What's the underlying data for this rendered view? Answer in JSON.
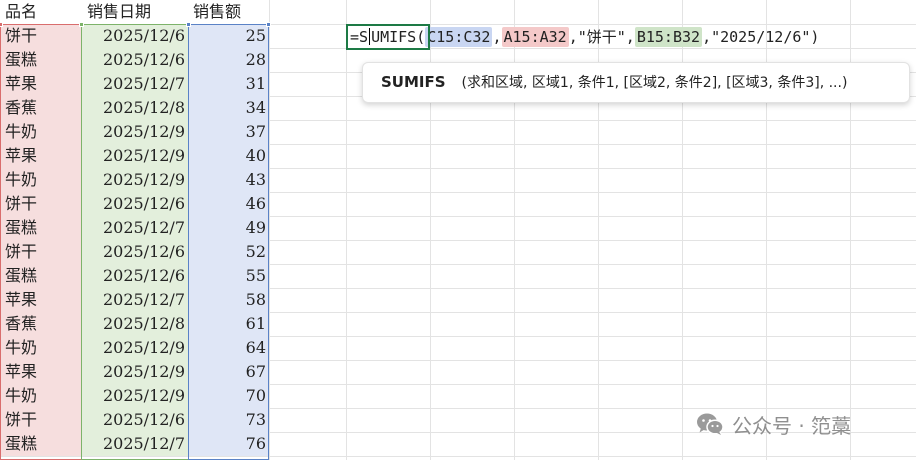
{
  "spreadsheet": {
    "headers": [
      "品名",
      "销售日期",
      "销售额"
    ],
    "rows": [
      [
        "饼干",
        "2025/12/6",
        "25"
      ],
      [
        "蛋糕",
        "2025/12/6",
        "28"
      ],
      [
        "苹果",
        "2025/12/7",
        "31"
      ],
      [
        "香蕉",
        "2025/12/8",
        "34"
      ],
      [
        "牛奶",
        "2025/12/9",
        "37"
      ],
      [
        "苹果",
        "2025/12/9",
        "40"
      ],
      [
        "牛奶",
        "2025/12/9",
        "43"
      ],
      [
        "饼干",
        "2025/12/6",
        "46"
      ],
      [
        "蛋糕",
        "2025/12/7",
        "49"
      ],
      [
        "饼干",
        "2025/12/6",
        "52"
      ],
      [
        "蛋糕",
        "2025/12/6",
        "55"
      ],
      [
        "苹果",
        "2025/12/7",
        "58"
      ],
      [
        "香蕉",
        "2025/12/8",
        "61"
      ],
      [
        "牛奶",
        "2025/12/9",
        "64"
      ],
      [
        "苹果",
        "2025/12/9",
        "67"
      ],
      [
        "牛奶",
        "2025/12/9",
        "70"
      ],
      [
        "饼干",
        "2025/12/6",
        "73"
      ],
      [
        "蛋糕",
        "2025/12/7",
        "76"
      ]
    ]
  },
  "formula": {
    "prefix": "=S",
    "fn_rest": "UMIFS(",
    "ref_sum": "C15:C32",
    "sep1": ",",
    "ref_crit1": "A15:A32",
    "sep2": ",\"饼干\",",
    "ref_crit2": "B15:B32",
    "tail": ",\"2025/12/6\")"
  },
  "tooltip": {
    "function_name": "SUMIFS",
    "signature": "(求和区域, 区域1, 条件1, [区域2, 条件2], [区域3, 条件3], ...)"
  },
  "watermark": {
    "icon": "wechat-icon",
    "text": "公众号 · 笵藁"
  },
  "colors": {
    "range_red": "#d96d6d",
    "range_green": "#7db36a",
    "range_blue": "#5a82c6",
    "active_cell_border": "#1d7a45"
  }
}
